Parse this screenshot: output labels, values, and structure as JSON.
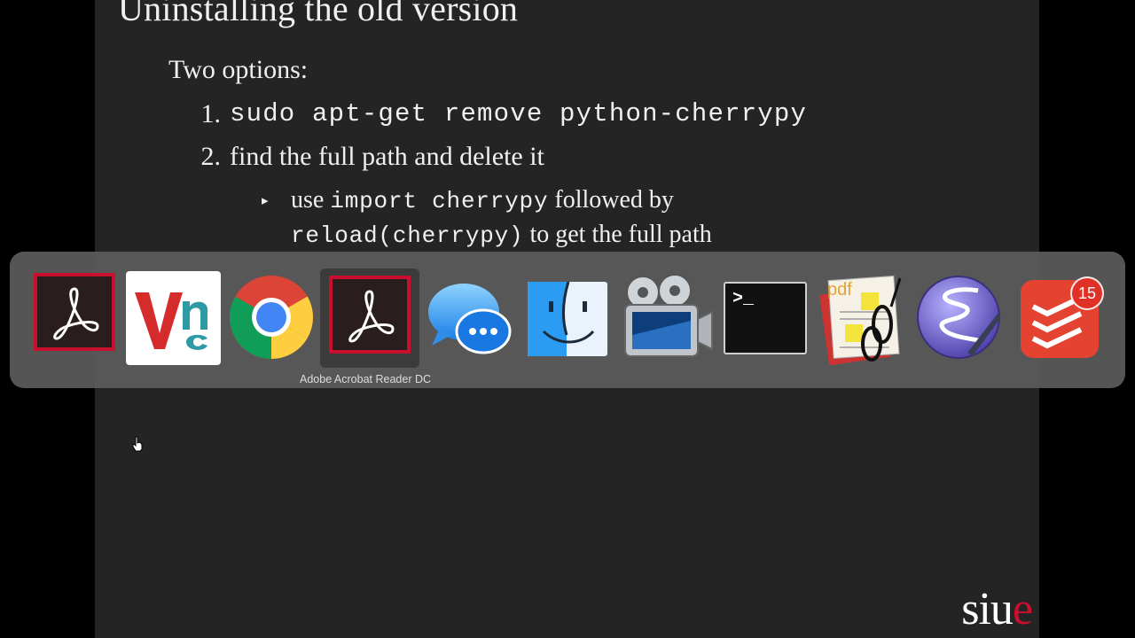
{
  "slide": {
    "title": "Uninstalling the old version",
    "intro": "Two options:",
    "option1_num": "1.",
    "option1_cmd": "sudo apt-get remove python-cherrypy",
    "option2_num": "2.",
    "option2_text": "find the full path and delete it",
    "sub_bullet": "▸",
    "sub_word_use": "use",
    "sub_code_import": "import cherrypy",
    "sub_word_followed": "followed by",
    "sub_code_reload": "reload(cherrypy)",
    "sub_word_rest": "to get the full path",
    "logo_si": "siu",
    "logo_e": "e"
  },
  "dock": {
    "apps": [
      {
        "icon": "adobe-acrobat-icon"
      },
      {
        "icon": "vnc-viewer-icon"
      },
      {
        "icon": "chrome-icon"
      },
      {
        "icon": "adobe-acrobat-icon"
      },
      {
        "icon": "messages-icon"
      },
      {
        "icon": "finder-icon"
      },
      {
        "icon": "photo-booth-icon"
      },
      {
        "icon": "terminal-icon"
      },
      {
        "icon": "preview-pdf-icon"
      },
      {
        "icon": "emacs-icon"
      },
      {
        "icon": "todoist-icon"
      }
    ],
    "tooltip": "Adobe Acrobat Reader DC",
    "terminal_prompt": ">_",
    "pdf_label": "pdf",
    "todoist_badge": "15"
  },
  "colors": {
    "slide_bg": "#242424",
    "acrobat_red": "#c8102e",
    "logo_red": "#c8102e",
    "badge_red": "#e03127"
  }
}
